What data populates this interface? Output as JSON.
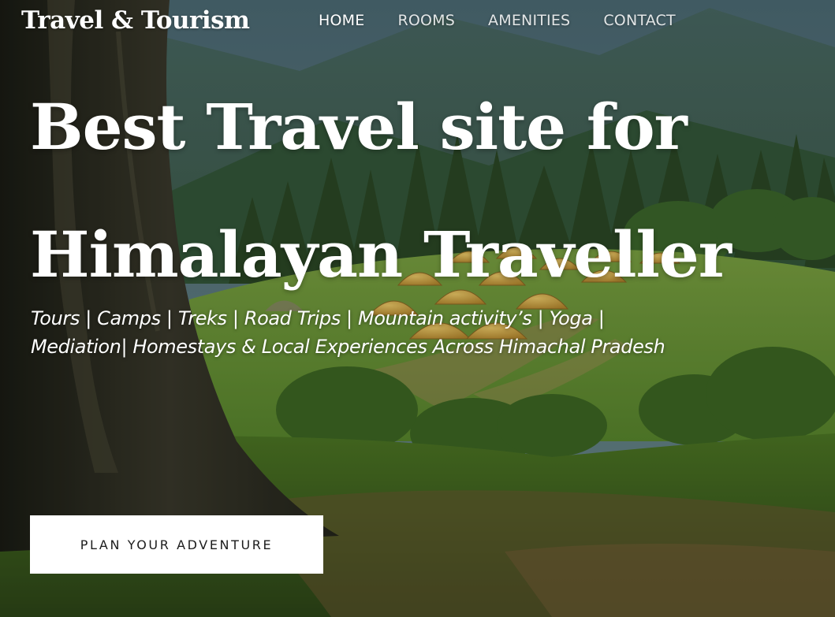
{
  "site": {
    "logo": "Travel & Tourism"
  },
  "nav": {
    "items": [
      {
        "label": "HOME",
        "active": true
      },
      {
        "label": "ROOMS",
        "active": false
      },
      {
        "label": "AMENITIES",
        "active": false
      },
      {
        "label": "CONTACT",
        "active": false
      }
    ]
  },
  "hero": {
    "title_lines": [
      "Best Travel site for",
      "Himalayan Traveller"
    ],
    "tagline_lines": [
      "Tours  |  Camps  |  Treks  |  Road  Trips  |  Mountain  activity’s  |  Yoga  |",
      "Mediation| Homestays & Local Experiences Across Himachal Pradesh"
    ],
    "cta_label": "PLAN YOUR ADVENTURE"
  },
  "colors": {
    "text": "#ffffff",
    "button_bg": "#ffffff",
    "button_text": "#1c1c1c",
    "sky": "#5d7d85",
    "meadow": "#6f9a3a",
    "tent": "#d9ad4a",
    "trunk": "#2b2c22"
  },
  "background": {
    "scene": "mountain meadow with camping tents and pine forest"
  }
}
